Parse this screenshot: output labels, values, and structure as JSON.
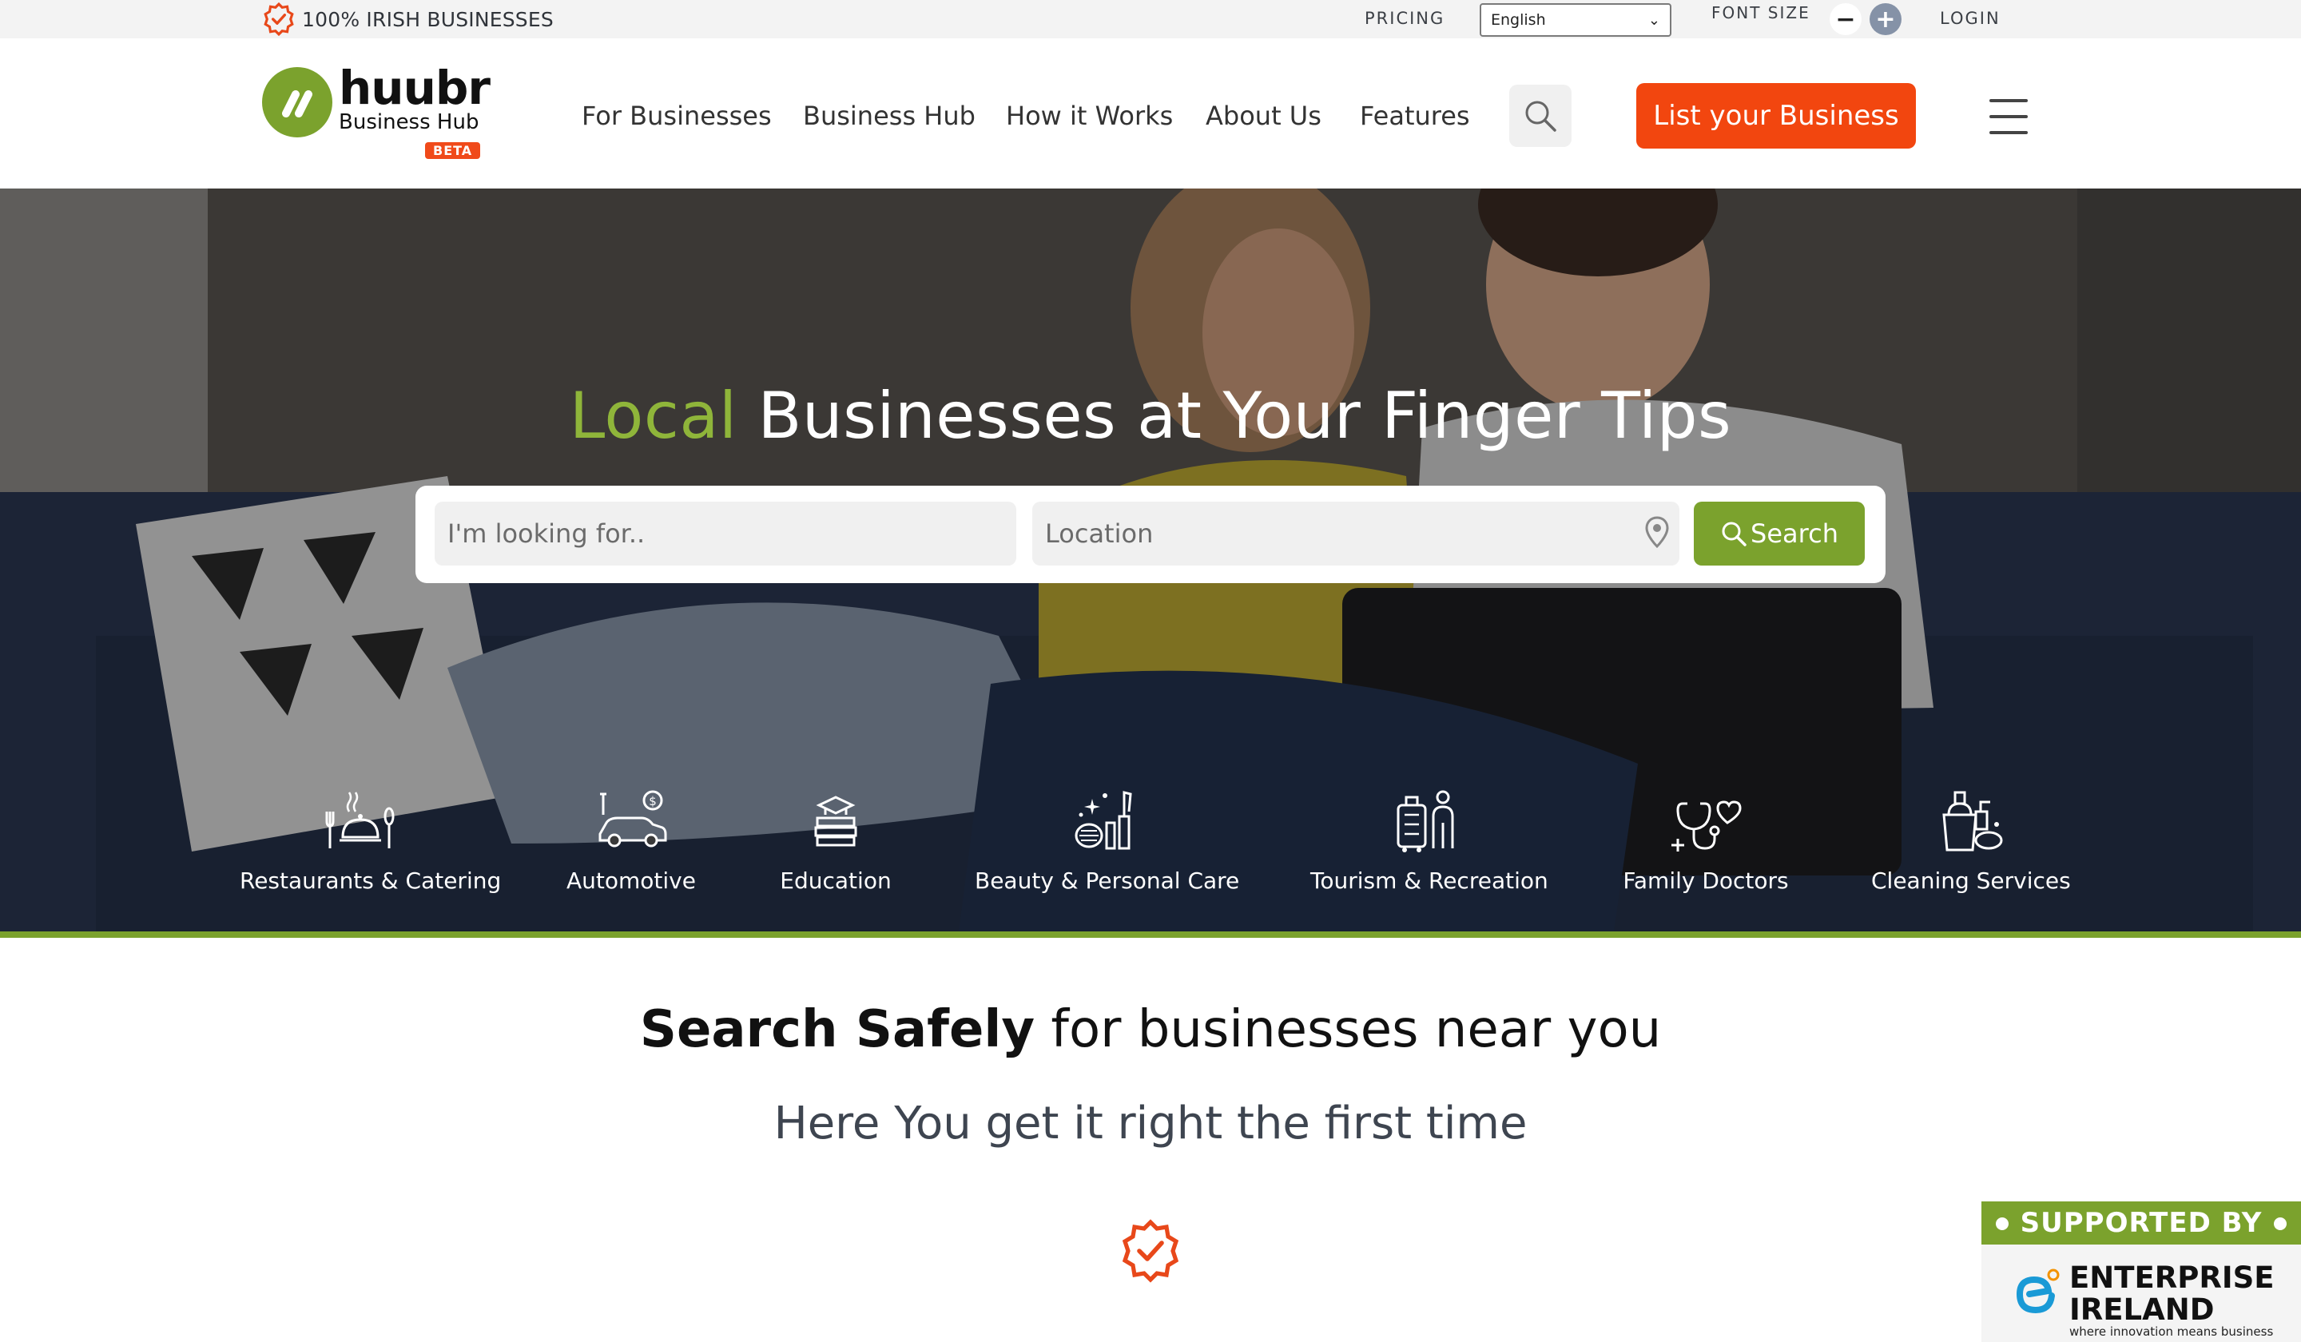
{
  "topbar": {
    "irish_label": "100% IRISH BUSINESSES",
    "pricing": "PRICING",
    "language_selected": "English",
    "font_size_label": "FONT SIZE",
    "font_minus": "−",
    "font_plus": "+",
    "login": "LOGIN"
  },
  "header": {
    "logo_word": "huubr",
    "logo_sub": "Business Hub",
    "logo_badge": "BETA",
    "nav": [
      "For Businesses",
      "Business Hub",
      "How it Works",
      "About Us",
      "Features"
    ],
    "cta": "List your Business"
  },
  "hero": {
    "title_accent": "Local",
    "title_rest": "Businesses at Your Finger Tips",
    "search_placeholder": "I'm looking for..",
    "location_placeholder": "Location",
    "search_button": "Search",
    "categories": [
      {
        "label": "Restaurants & Catering",
        "icon": "restaurant-icon"
      },
      {
        "label": "Automotive",
        "icon": "automotive-icon"
      },
      {
        "label": "Education",
        "icon": "education-icon"
      },
      {
        "label": "Beauty & Personal Care",
        "icon": "beauty-icon"
      },
      {
        "label": "Tourism & Recreation",
        "icon": "tourism-icon"
      },
      {
        "label": "Family Doctors",
        "icon": "doctor-icon"
      },
      {
        "label": "Cleaning Services",
        "icon": "cleaning-icon"
      }
    ]
  },
  "safe": {
    "title_bold": "Search Safely",
    "title_rest": "for businesses near you",
    "subtitle": "Here You get it right the first time"
  },
  "supported": {
    "label": "SUPPORTED BY",
    "org_line1": "ENTERPRISE",
    "org_line2": "IRELAND",
    "tagline": "where innovation means business"
  },
  "colors": {
    "brand_green": "#7ba22d",
    "cta_orange": "#f2460f",
    "badge_orange": "#f04a1a"
  }
}
